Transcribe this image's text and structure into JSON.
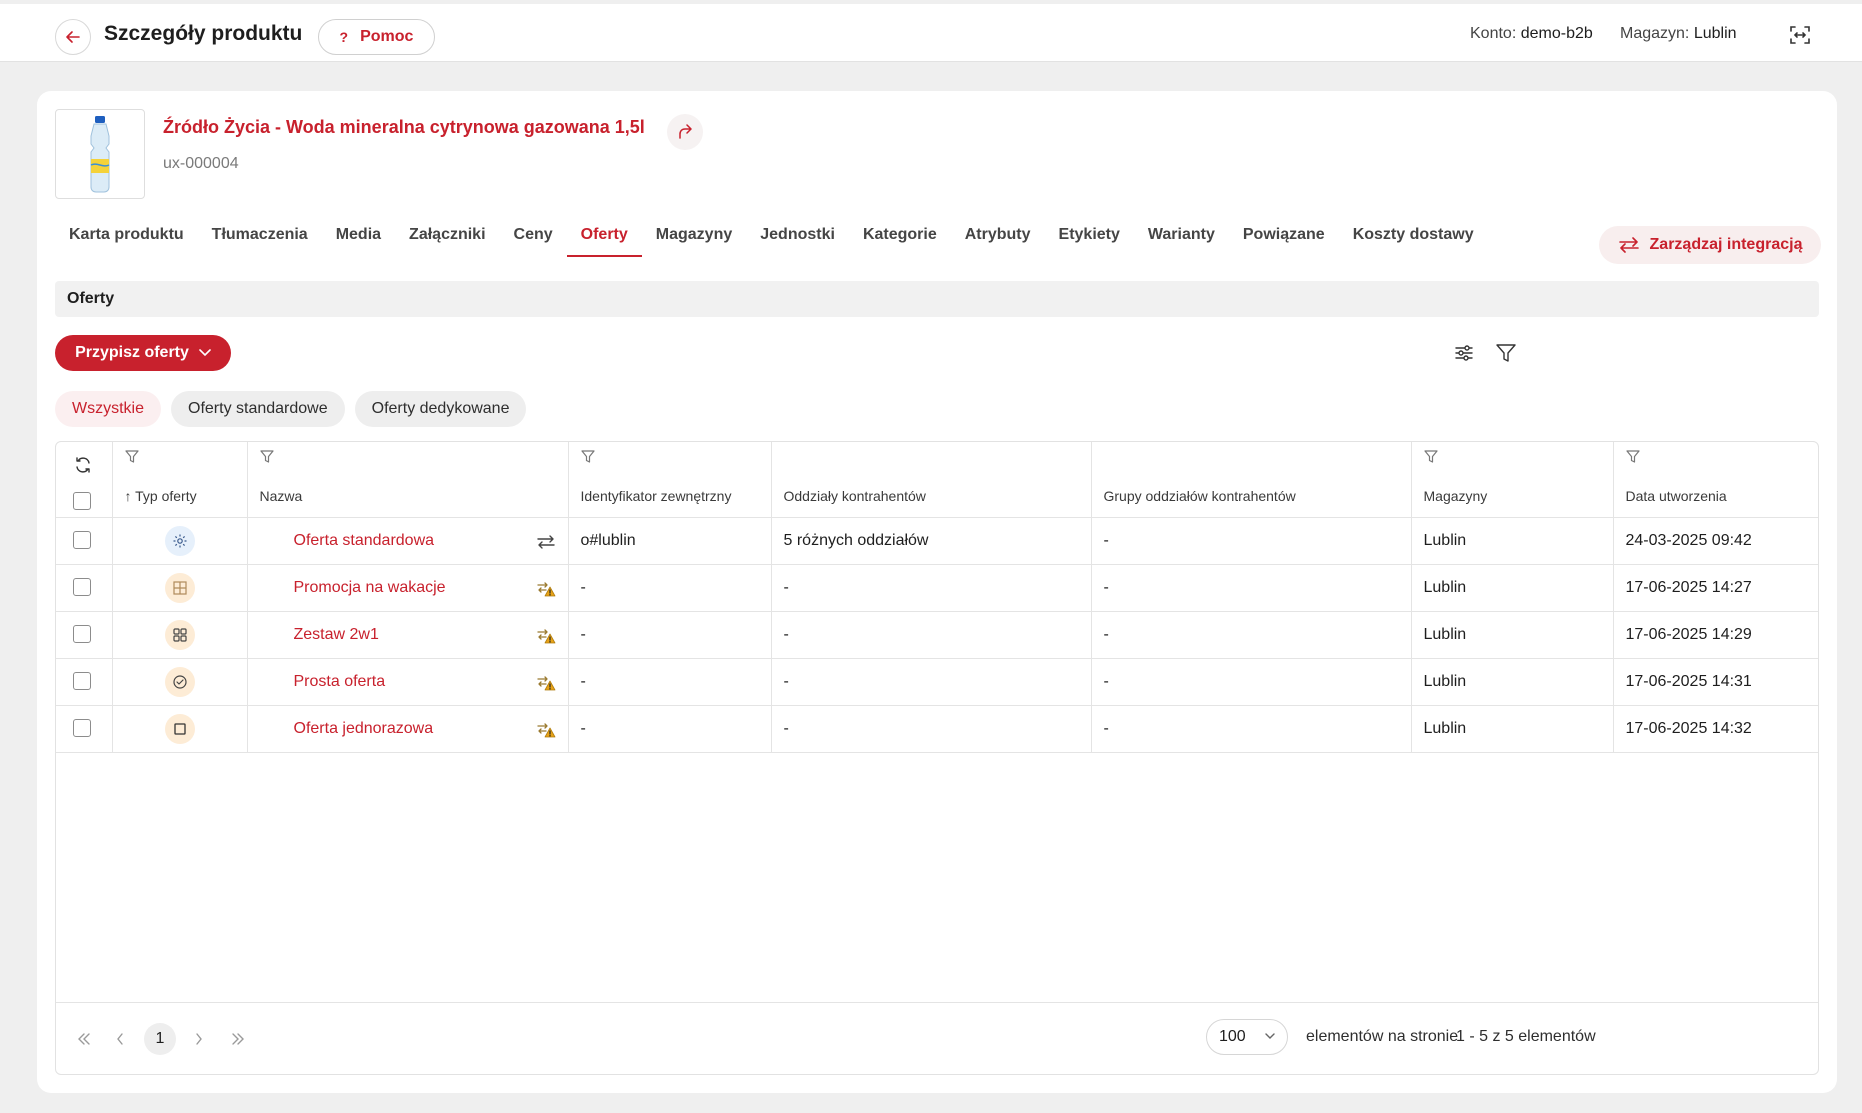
{
  "header": {
    "title": "Szczegóły produktu",
    "help_label": "Pomoc",
    "help_mark": "?",
    "account_label": "Konto:",
    "account_value": "demo-b2b",
    "warehouse_label": "Magazyn:",
    "warehouse_value": "Lublin"
  },
  "product": {
    "name": "Źródło Życia - Woda mineralna cytrynowa gazowana 1,5l",
    "code": "ux-000004"
  },
  "tabs": [
    {
      "label": "Karta produktu",
      "active": false
    },
    {
      "label": "Tłumaczenia",
      "active": false
    },
    {
      "label": "Media",
      "active": false
    },
    {
      "label": "Załączniki",
      "active": false
    },
    {
      "label": "Ceny",
      "active": false
    },
    {
      "label": "Oferty",
      "active": true
    },
    {
      "label": "Magazyny",
      "active": false
    },
    {
      "label": "Jednostki",
      "active": false
    },
    {
      "label": "Kategorie",
      "active": false
    },
    {
      "label": "Atrybuty",
      "active": false
    },
    {
      "label": "Etykiety",
      "active": false
    },
    {
      "label": "Warianty",
      "active": false
    },
    {
      "label": "Powiązane",
      "active": false
    },
    {
      "label": "Koszty dostawy",
      "active": false
    }
  ],
  "integration_button": "Zarządzaj integracją",
  "section_title": "Oferty",
  "assign_button": "Przypisz oferty",
  "filters": [
    {
      "label": "Wszystkie",
      "active": true
    },
    {
      "label": "Oferty standardowe",
      "active": false
    },
    {
      "label": "Oferty dedykowane",
      "active": false
    }
  ],
  "table": {
    "columns": [
      "Typ oferty",
      "Nazwa",
      "Identyfikator zewnętrzny",
      "Oddziały kontrahentów",
      "Grupy oddziałów kontrahentów",
      "Magazyny",
      "Data utworzenia"
    ],
    "rows": [
      {
        "type_icon": "gear-icon",
        "name": "Oferta standardowa",
        "sync_icon": "sync-arrows-icon",
        "external_id": "o#lublin",
        "branches": "5 różnych oddziałów",
        "branch_groups": "-",
        "warehouses": "Lublin",
        "created": "24-03-2025 09:42"
      },
      {
        "type_icon": "grid-icon",
        "name": "Promocja na wakacje",
        "sync_icon": "sync-warning-icon",
        "external_id": "-",
        "branches": "-",
        "branch_groups": "-",
        "warehouses": "Lublin",
        "created": "17-06-2025 14:27"
      },
      {
        "type_icon": "bundle-icon",
        "name": "Zestaw 2w1",
        "sync_icon": "sync-warning-icon",
        "external_id": "-",
        "branches": "-",
        "branch_groups": "-",
        "warehouses": "Lublin",
        "created": "17-06-2025 14:29"
      },
      {
        "type_icon": "check-badge-icon",
        "name": "Prosta oferta",
        "sync_icon": "sync-warning-icon",
        "external_id": "-",
        "branches": "-",
        "branch_groups": "-",
        "warehouses": "Lublin",
        "created": "17-06-2025 14:31"
      },
      {
        "type_icon": "square-icon",
        "name": "Oferta jednorazowa",
        "sync_icon": "sync-warning-icon",
        "external_id": "-",
        "branches": "-",
        "branch_groups": "-",
        "warehouses": "Lublin",
        "created": "17-06-2025 14:32"
      }
    ]
  },
  "pagination": {
    "current_page": "1",
    "per_page": "100",
    "per_page_label": "elementów na stronie",
    "range_label": "1 - 5 z 5 elementów"
  },
  "colors": {
    "accent": "#c8212d",
    "background": "#efefef"
  }
}
